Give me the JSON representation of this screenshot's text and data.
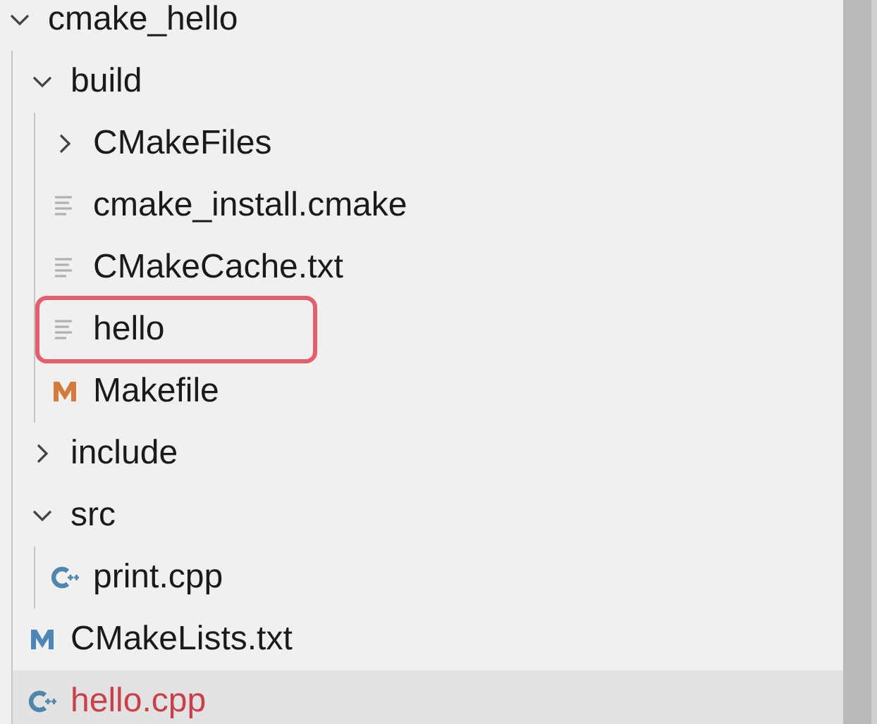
{
  "tree": [
    {
      "kind": "folder",
      "name": "cmake_hello",
      "expanded": true,
      "selected": false,
      "children": [
        {
          "kind": "folder",
          "name": "build",
          "expanded": true,
          "selected": false,
          "children": [
            {
              "kind": "folder",
              "name": "CMakeFiles",
              "expanded": false,
              "selected": false
            },
            {
              "kind": "text",
              "name": "cmake_install.cmake",
              "selected": false
            },
            {
              "kind": "text",
              "name": "CMakeCache.txt",
              "selected": false
            },
            {
              "kind": "text",
              "name": "hello",
              "selected": false,
              "highlighted": true
            },
            {
              "kind": "makefile",
              "name": "Makefile",
              "selected": false
            }
          ]
        },
        {
          "kind": "folder",
          "name": "include",
          "expanded": false,
          "selected": false
        },
        {
          "kind": "folder",
          "name": "src",
          "expanded": true,
          "selected": false,
          "children": [
            {
              "kind": "cpp",
              "name": "print.cpp",
              "selected": false
            }
          ]
        },
        {
          "kind": "cmake",
          "name": "CMakeLists.txt",
          "selected": false
        },
        {
          "kind": "cpp",
          "name": "hello.cpp",
          "selected": true,
          "error": true
        }
      ]
    }
  ]
}
